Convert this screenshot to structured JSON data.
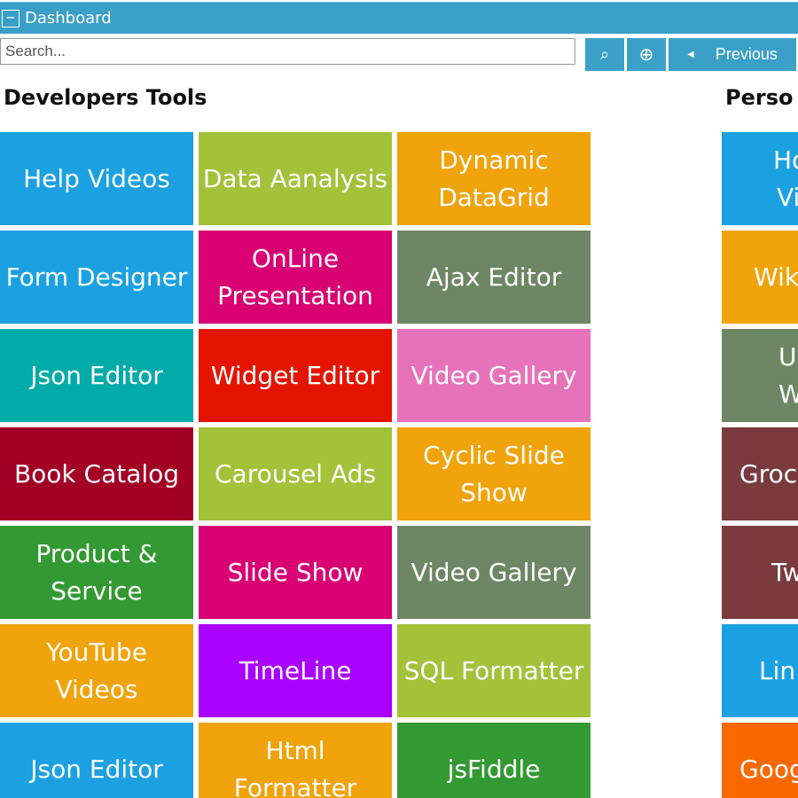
{
  "titlebar": {
    "collapse_symbol": "−",
    "title": "Dashboard"
  },
  "search": {
    "placeholder": "Search..."
  },
  "toolbar": {
    "search_symbol": "⌕",
    "add_symbol": "⊕",
    "prev_arrow": "◀",
    "prev_label": "Previous"
  },
  "sections": {
    "developers": {
      "title": "Developers Tools"
    },
    "personal": {
      "title": "Perso"
    }
  },
  "tiles": [
    {
      "label": "Help Videos",
      "color": "#1ba1e2"
    },
    {
      "label": "Data Aanalysis",
      "color": "#a4c13a"
    },
    {
      "label": "Dynamic DataGrid",
      "color": "#f0a30a"
    },
    {
      "label": "Form Designer",
      "color": "#1ba1e2"
    },
    {
      "label": "OnLine Presentation",
      "color": "#d80073"
    },
    {
      "label": "Ajax Editor",
      "color": "#6d8764"
    },
    {
      "label": "Json Editor",
      "color": "#00aba9"
    },
    {
      "label": "Widget Editor",
      "color": "#e51400"
    },
    {
      "label": "Video Gallery",
      "color": "#e672b9"
    },
    {
      "label": "Book Catalog",
      "color": "#a20025"
    },
    {
      "label": "Carousel Ads",
      "color": "#a4c13a"
    },
    {
      "label": "Cyclic Slide Show",
      "color": "#f0a30a"
    },
    {
      "label": "Product & Service",
      "color": "#339933"
    },
    {
      "label": "Slide Show",
      "color": "#d80073"
    },
    {
      "label": "Video Gallery",
      "color": "#6d8764"
    },
    {
      "label": "YouTube Videos",
      "color": "#f0a30a"
    },
    {
      "label": "TimeLine",
      "color": "#aa00ff"
    },
    {
      "label": "SQL Formatter",
      "color": "#a4c13a"
    },
    {
      "label": "Json Editor",
      "color": "#1ba1e2"
    },
    {
      "label": "Html Formatter",
      "color": "#f0a30a"
    },
    {
      "label": "jsFiddle",
      "color": "#339933"
    }
  ],
  "right_tiles": [
    {
      "line1": "Ho",
      "line2": "Vi",
      "color": "#1ba1e2"
    },
    {
      "line1": "Wik",
      "line2": "",
      "color": "#f0a30a"
    },
    {
      "line1": "U",
      "line2": "Wi",
      "color": "#6d8764"
    },
    {
      "line1": "Groc",
      "line2": "",
      "color": "#7a3b3f"
    },
    {
      "line1": "Tw",
      "line2": "",
      "color": "#7a3b3f"
    },
    {
      "line1": "Lin",
      "line2": "",
      "color": "#1ba1e2"
    },
    {
      "line1": "Goog",
      "line2": "",
      "color": "#fa6800"
    }
  ]
}
